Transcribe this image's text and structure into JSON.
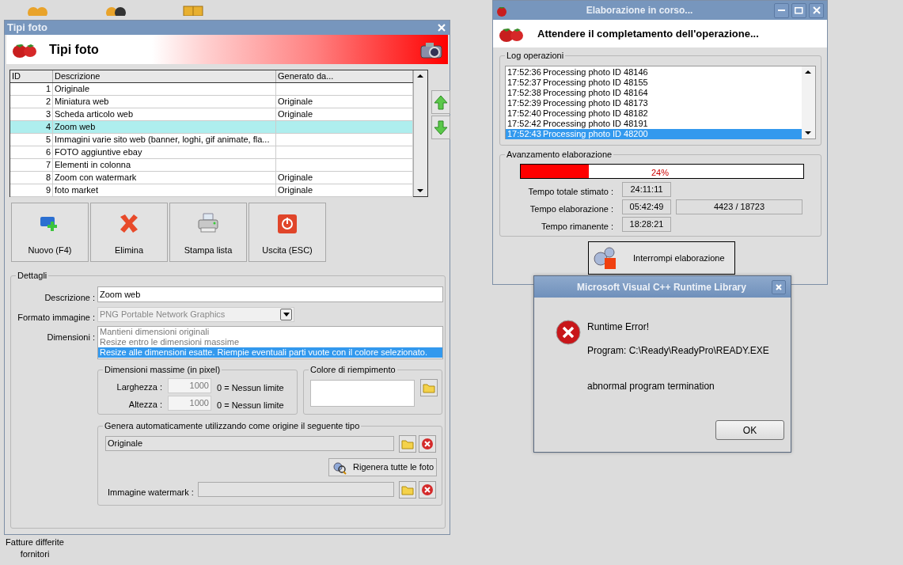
{
  "desktop": {
    "label": "Fatture differite fornitori"
  },
  "tipi_foto": {
    "title": "Tipi foto",
    "header": "Tipi foto",
    "columns": [
      "ID",
      "Descrizione",
      "Generato da..."
    ],
    "rows": [
      {
        "id": "1",
        "descrizione": "Originale",
        "generato_da": "",
        "selected": false
      },
      {
        "id": "2",
        "descrizione": "Miniatura web",
        "generato_da": "Originale",
        "selected": false
      },
      {
        "id": "3",
        "descrizione": "Scheda articolo web",
        "generato_da": "Originale",
        "selected": false
      },
      {
        "id": "4",
        "descrizione": "Zoom web",
        "generato_da": "",
        "selected": true
      },
      {
        "id": "5",
        "descrizione": "Immagini varie sito web (banner, loghi, gif animate, fla...",
        "generato_da": "",
        "selected": false
      },
      {
        "id": "6",
        "descrizione": "FOTO aggiuntive ebay",
        "generato_da": "",
        "selected": false
      },
      {
        "id": "7",
        "descrizione": "Elementi in colonna",
        "generato_da": "",
        "selected": false
      },
      {
        "id": "8",
        "descrizione": "Zoom con watermark",
        "generato_da": "Originale",
        "selected": false
      },
      {
        "id": "9",
        "descrizione": "foto market",
        "generato_da": "Originale",
        "selected": false
      }
    ],
    "buttons": [
      {
        "kind": "new",
        "label": "Nuovo (F4)"
      },
      {
        "kind": "delete",
        "label": "Elimina"
      },
      {
        "kind": "print",
        "label": "Stampa lista"
      },
      {
        "kind": "exit",
        "label": "Uscita (ESC)"
      }
    ],
    "details": {
      "legend": "Dettagli",
      "descrizione": {
        "label": "Descrizione :",
        "value": "Zoom web"
      },
      "formato": {
        "label": "Formato immagine :",
        "value": "PNG Portable Network Graphics"
      },
      "dimensioni": {
        "label": "Dimensioni :",
        "options": [
          {
            "label": "Mantieni dimensioni originali",
            "selected": false
          },
          {
            "label": "Resize entro le dimensioni massime",
            "selected": false
          },
          {
            "label": "Resize alle dimensioni esatte. Riempie eventuali parti vuote con il colore selezionato.",
            "selected": true
          }
        ]
      },
      "max_dims": {
        "legend": "Dimensioni massime (in pixel)",
        "fields": [
          {
            "label": "Larghezza :",
            "value": "1000",
            "hint": "0 = Nessun limite"
          },
          {
            "label": "Altezza :",
            "value": "1000",
            "hint": "0 = Nessun limite"
          }
        ]
      },
      "colore": {
        "legend": "Colore di riempimento"
      },
      "genera": {
        "legend": "Genera automaticamente utilizzando come origine il seguente tipo",
        "origin": "Originale",
        "rigenera": "Rigenera tutte le foto",
        "watermark_label": "Immagine watermark :"
      }
    }
  },
  "progress_window": {
    "title": "Elaborazione in corso...",
    "header": "Attendere il completamento dell'operazione...",
    "log_legend": "Log operazioni",
    "log": [
      {
        "time": "17:52:36",
        "text": "Processing photo ID 48146",
        "selected": false
      },
      {
        "time": "17:52:37",
        "text": "Processing photo ID 48155",
        "selected": false
      },
      {
        "time": "17:52:38",
        "text": "Processing photo ID 48164",
        "selected": false
      },
      {
        "time": "17:52:39",
        "text": "Processing photo ID 48173",
        "selected": false
      },
      {
        "time": "17:52:40",
        "text": "Processing photo ID 48182",
        "selected": false
      },
      {
        "time": "17:52:42",
        "text": "Processing photo ID 48191",
        "selected": false
      },
      {
        "time": "17:52:43",
        "text": "Processing photo ID 48200",
        "selected": true
      }
    ],
    "progress_legend": "Avanzamento elaborazione",
    "level": 0.24,
    "percent": "24%",
    "times": [
      {
        "label": "Tempo totale stimato :",
        "value": "24:11:11"
      },
      {
        "label": "Tempo elaborazione :",
        "value": "05:42:49",
        "extra": "4423 / 18723"
      },
      {
        "label": "Tempo rimanente :",
        "value": "18:28:21"
      }
    ],
    "stop_button": "Interrompi elaborazione"
  },
  "error_dialog": {
    "title": "Microsoft Visual C++ Runtime Library",
    "heading": "Runtime Error!",
    "program": "Program: C:\\Ready\\ReadyPro\\READY.EXE",
    "message": "abnormal program termination",
    "ok": "OK"
  }
}
